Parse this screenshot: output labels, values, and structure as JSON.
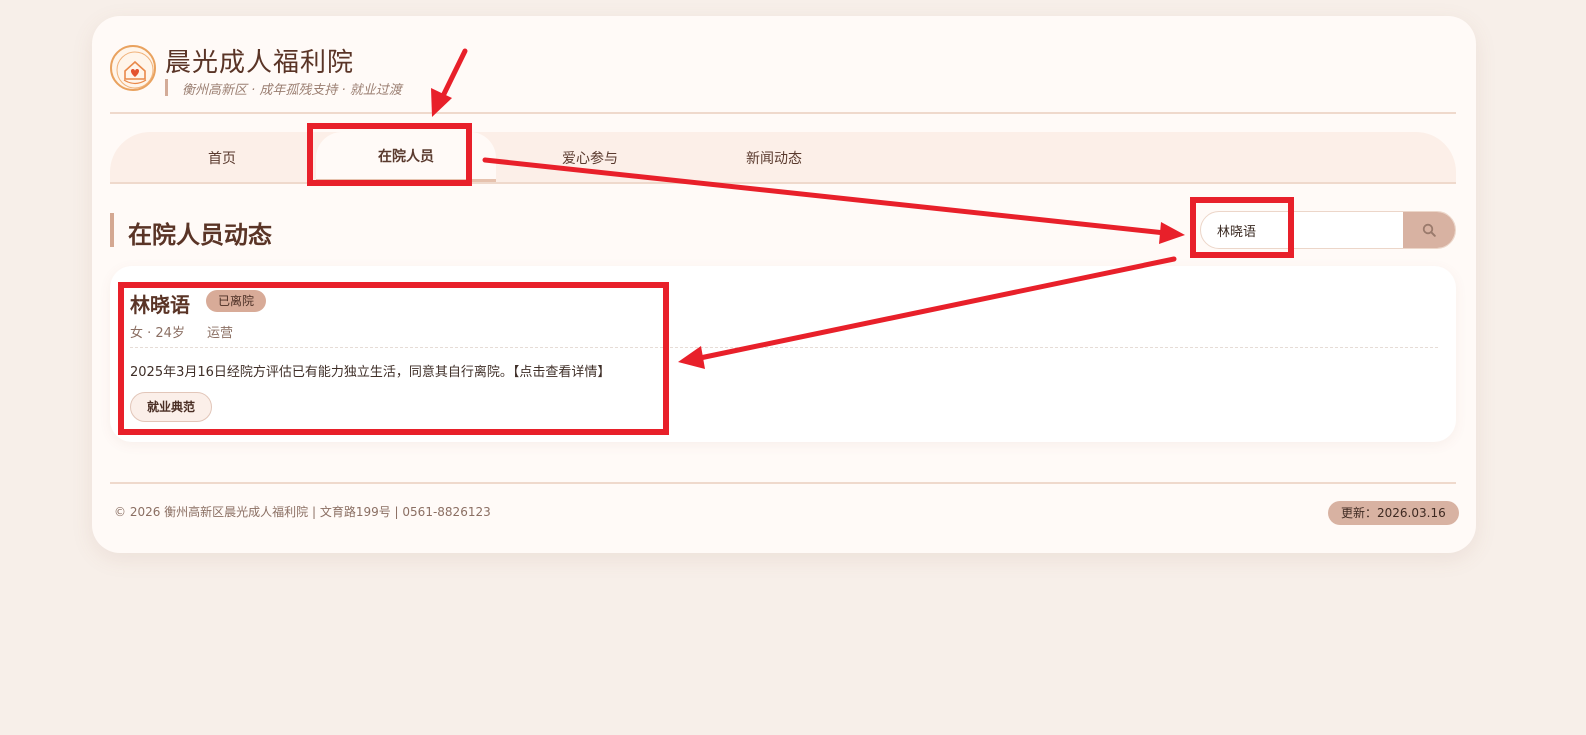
{
  "header": {
    "title": "晨光成人福利院",
    "subtitle": "衡州高新区 · 成年孤残支持 · 就业过渡",
    "logo_icon": "heart-house-logo-icon"
  },
  "nav": {
    "items": [
      {
        "label": "首页",
        "active": false
      },
      {
        "label": "在院人员",
        "active": true
      },
      {
        "label": "爱心参与",
        "active": false
      },
      {
        "label": "新闻动态",
        "active": false
      }
    ]
  },
  "section": {
    "title": "在院人员动态"
  },
  "search": {
    "value": "林晓语",
    "button_icon": "search-icon"
  },
  "resident": {
    "name": "林晓语",
    "status": "已离院",
    "gender_age": "女 · 24岁",
    "role": "运营",
    "description": "2025年3月16日经院方评估已有能力独立生活，同意其自行离院。",
    "detail_link": "【点击查看详情】",
    "tag": "就业典范"
  },
  "footer": {
    "copyright": "© 2026 衡州高新区晨光成人福利院 | 文育路199号 | 0561-8826123",
    "update": "更新：2026.03.16"
  },
  "colors": {
    "accent": "#d8b2a2",
    "annotation": "#e8202a",
    "page_bg": "#f7efe9"
  }
}
